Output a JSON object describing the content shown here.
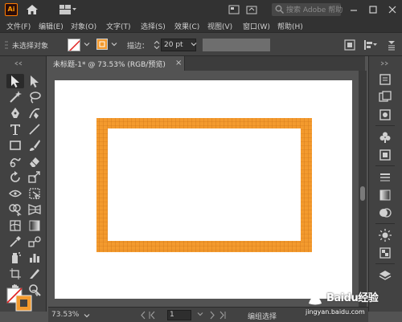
{
  "app": {
    "logo_text": "Ai",
    "search_placeholder": "搜索 Adobe 帮助"
  },
  "menu": [
    "文件(F)",
    "编辑(E)",
    "对象(O)",
    "文字(T)",
    "选择(S)",
    "效果(C)",
    "视图(V)",
    "窗口(W)",
    "帮助(H)"
  ],
  "control_bar": {
    "selection_status": "未选择对象",
    "stroke_label": "描边：",
    "stroke_weight": "20 pt",
    "stroke_color": "#f39a2e"
  },
  "document_tab": {
    "title": "未标题-1* @ 73.53% (RGB/预览)",
    "close_label": "×"
  },
  "status_bar": {
    "zoom": "73.53%",
    "artboard_number": "1",
    "tool_status": "编组选择"
  },
  "artwork": {
    "frame_color": "#f39a2e",
    "grid_line_color": "#c96e12"
  },
  "watermark": {
    "brand": "Baidu经验",
    "url": "jingyan.baidu.com"
  }
}
